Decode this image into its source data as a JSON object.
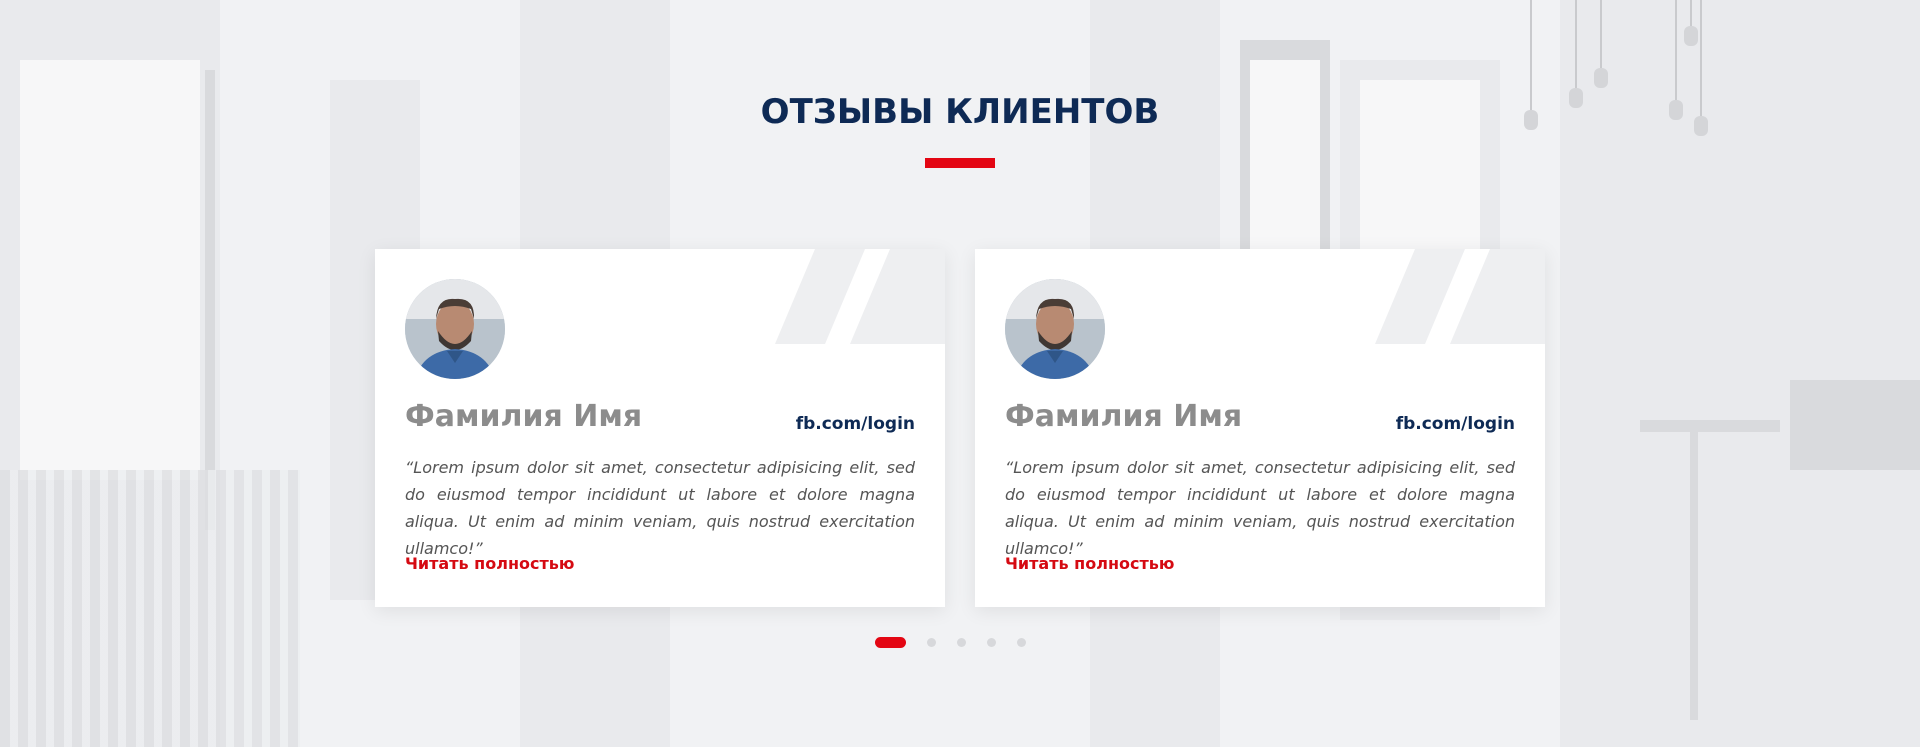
{
  "section": {
    "title": "ОТЗЫВЫ КЛИЕНТОВ"
  },
  "colors": {
    "title": "#0e2a55",
    "accent": "#e30613",
    "name": "#8c8c8c",
    "link": "#d50a12"
  },
  "testimonials": [
    {
      "avatar_icon": "person-photo",
      "name": "Фамилия Имя",
      "social": "fb.com/login",
      "text": "“Lorem ipsum dolor sit amet, consectetur adipisicing elit, sed do eiusmod tempor incididunt ut labore et dolore magna aliqua. Ut enim ad minim veniam, quis nostrud exercitation ullamco!”",
      "more_label": "Читать полностью"
    },
    {
      "avatar_icon": "person-photo",
      "name": "Фамилия Имя",
      "social": "fb.com/login",
      "text": "“Lorem ipsum dolor sit amet, consectetur adipisicing elit, sed do eiusmod tempor incididunt ut labore et dolore magna aliqua. Ut enim ad minim veniam, quis nostrud exercitation ullamco!”",
      "more_label": "Читать полностью"
    }
  ],
  "pagination": {
    "total": 5,
    "active": 1
  }
}
